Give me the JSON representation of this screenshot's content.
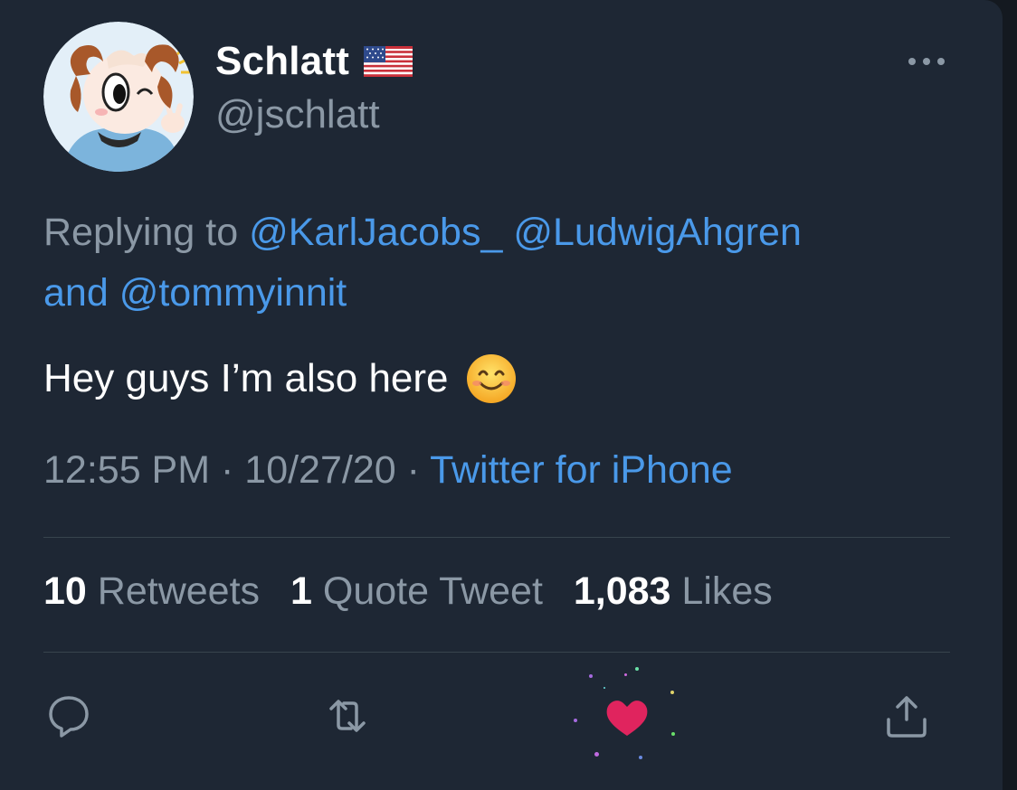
{
  "tweet": {
    "display_name": "Schlatt",
    "flag_icon": "us-flag-emoji",
    "handle": "@jschlatt",
    "replying_prefix": "Replying to ",
    "mentions": [
      "@KarlJacobs_",
      "@LudwigAhgren",
      "@tommyinnit"
    ],
    "mention_joiner_and": "and ",
    "text": "Hey guys I’m also here",
    "text_emoji": "smiling-face-with-smiling-eyes-emoji",
    "time": "12:55 PM",
    "date": "10/27/20",
    "separator": " · ",
    "source": "Twitter for iPhone"
  },
  "stats": {
    "retweets_count": "10",
    "retweets_label": "Retweets",
    "quotes_count": "1",
    "quotes_label": "Quote Tweet",
    "likes_count": "1,083",
    "likes_label": "Likes"
  },
  "actions": {
    "reply_icon": "reply-bubble-icon",
    "retweet_icon": "retweet-icon",
    "like_icon": "heart-filled-icon",
    "share_icon": "share-upload-icon"
  },
  "colors": {
    "background": "#1e2734",
    "link": "#4a99e9",
    "muted": "#8b98a5",
    "like": "#e0245e"
  }
}
